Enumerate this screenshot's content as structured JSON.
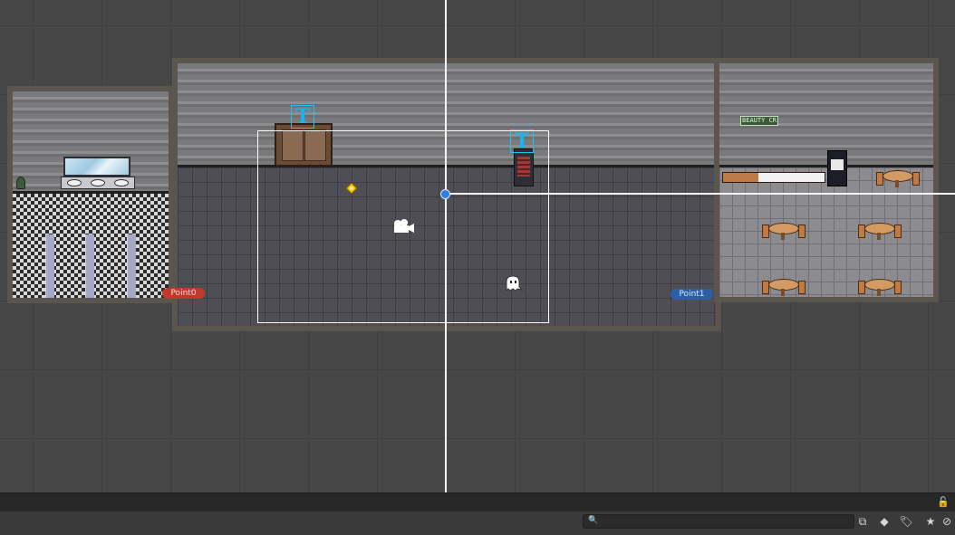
{
  "scene": {
    "spawn_points": [
      {
        "label": "Point0",
        "color": "#c0392b"
      },
      {
        "label": "Point1",
        "color": "#2d5fa8"
      }
    ],
    "text_marker_glyph": "T",
    "sign_text": "BEAUTY CR",
    "icons": {
      "camera": "camera-icon",
      "ghost": "ghost-icon",
      "light": "light-gizmo-icon"
    },
    "colors": {
      "selection_rect": "#ffffff",
      "text_marker": "#1ec3f0",
      "pivot": "#2f7fe0"
    }
  },
  "statusbar": {
    "lock_icon": "lock-icon"
  },
  "toolbar": {
    "search_icon": "🔍",
    "search_placeholder": "",
    "buttons": [
      {
        "name": "scene-view-toggle",
        "icon": "⧉"
      },
      {
        "name": "type-filter",
        "icon": "◆"
      },
      {
        "name": "label-filter",
        "icon": "🏷"
      },
      {
        "name": "favorites",
        "icon": "★"
      },
      {
        "name": "hidden-count",
        "icon": "⊘"
      }
    ]
  }
}
